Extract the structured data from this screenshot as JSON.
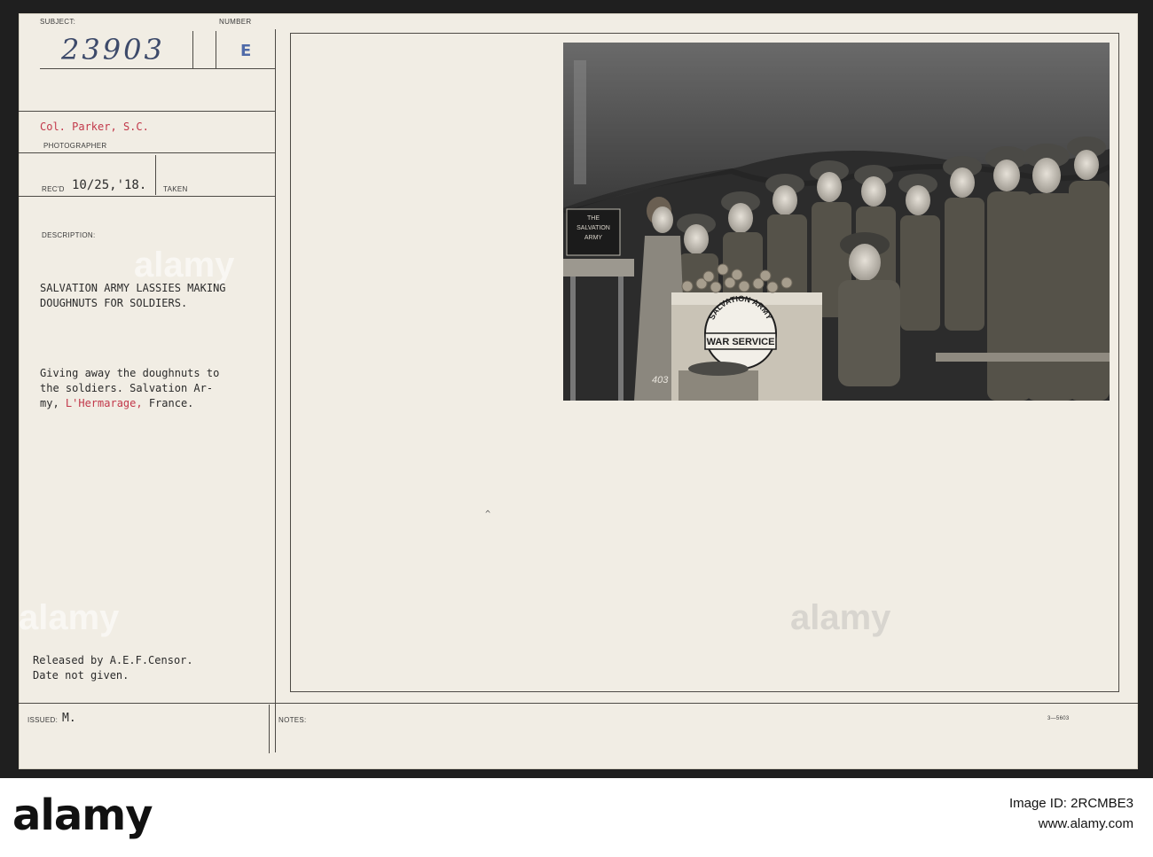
{
  "card": {
    "subject_label": "SUBJECT:",
    "number_label": "NUMBER",
    "subject_number": "23903",
    "number_value": "E",
    "photographer_name_1": "Col. Parker,",
    "photographer_name_2": "S.C.",
    "photographer_label": "PHOTOGRAPHER",
    "recd_label": "REC'D",
    "recd_date": "10/25,'18.",
    "taken_label": "TAKEN",
    "description_label": "DESCRIPTION:",
    "description_line1": "SALVATION ARMY LASSIES MAKING",
    "description_line2": "DOUGHNUTS FOR SOLDIERS.",
    "detail_line1": "Giving away the doughnuts to",
    "detail_line2": "the soldiers.  Salvation Ar-",
    "detail_line3_pre": "my, ",
    "detail_line3_red": "L'Hermarage,",
    "detail_line3_post": " France.",
    "released_line1": "Released by A.E.F.Censor.",
    "released_line2": "Date not given.",
    "issued_label": "ISSUED:",
    "issued_value": "M.",
    "notes_label": "NOTES:",
    "form_code": "3—5603"
  },
  "photo": {
    "sign_text_1": "THE",
    "sign_text_2": "SALVATION",
    "sign_text_3": "ARMY",
    "box_arc_text": "SALVATION ARMY",
    "box_banner_text": "WAR SERVICE",
    "photo_number": "403"
  },
  "watermarks": {
    "text": "alamy"
  },
  "footer": {
    "brand": "alamy",
    "image_id_label": "Image ID:",
    "image_id": "2RCMBE3",
    "site": "www.alamy.com"
  }
}
